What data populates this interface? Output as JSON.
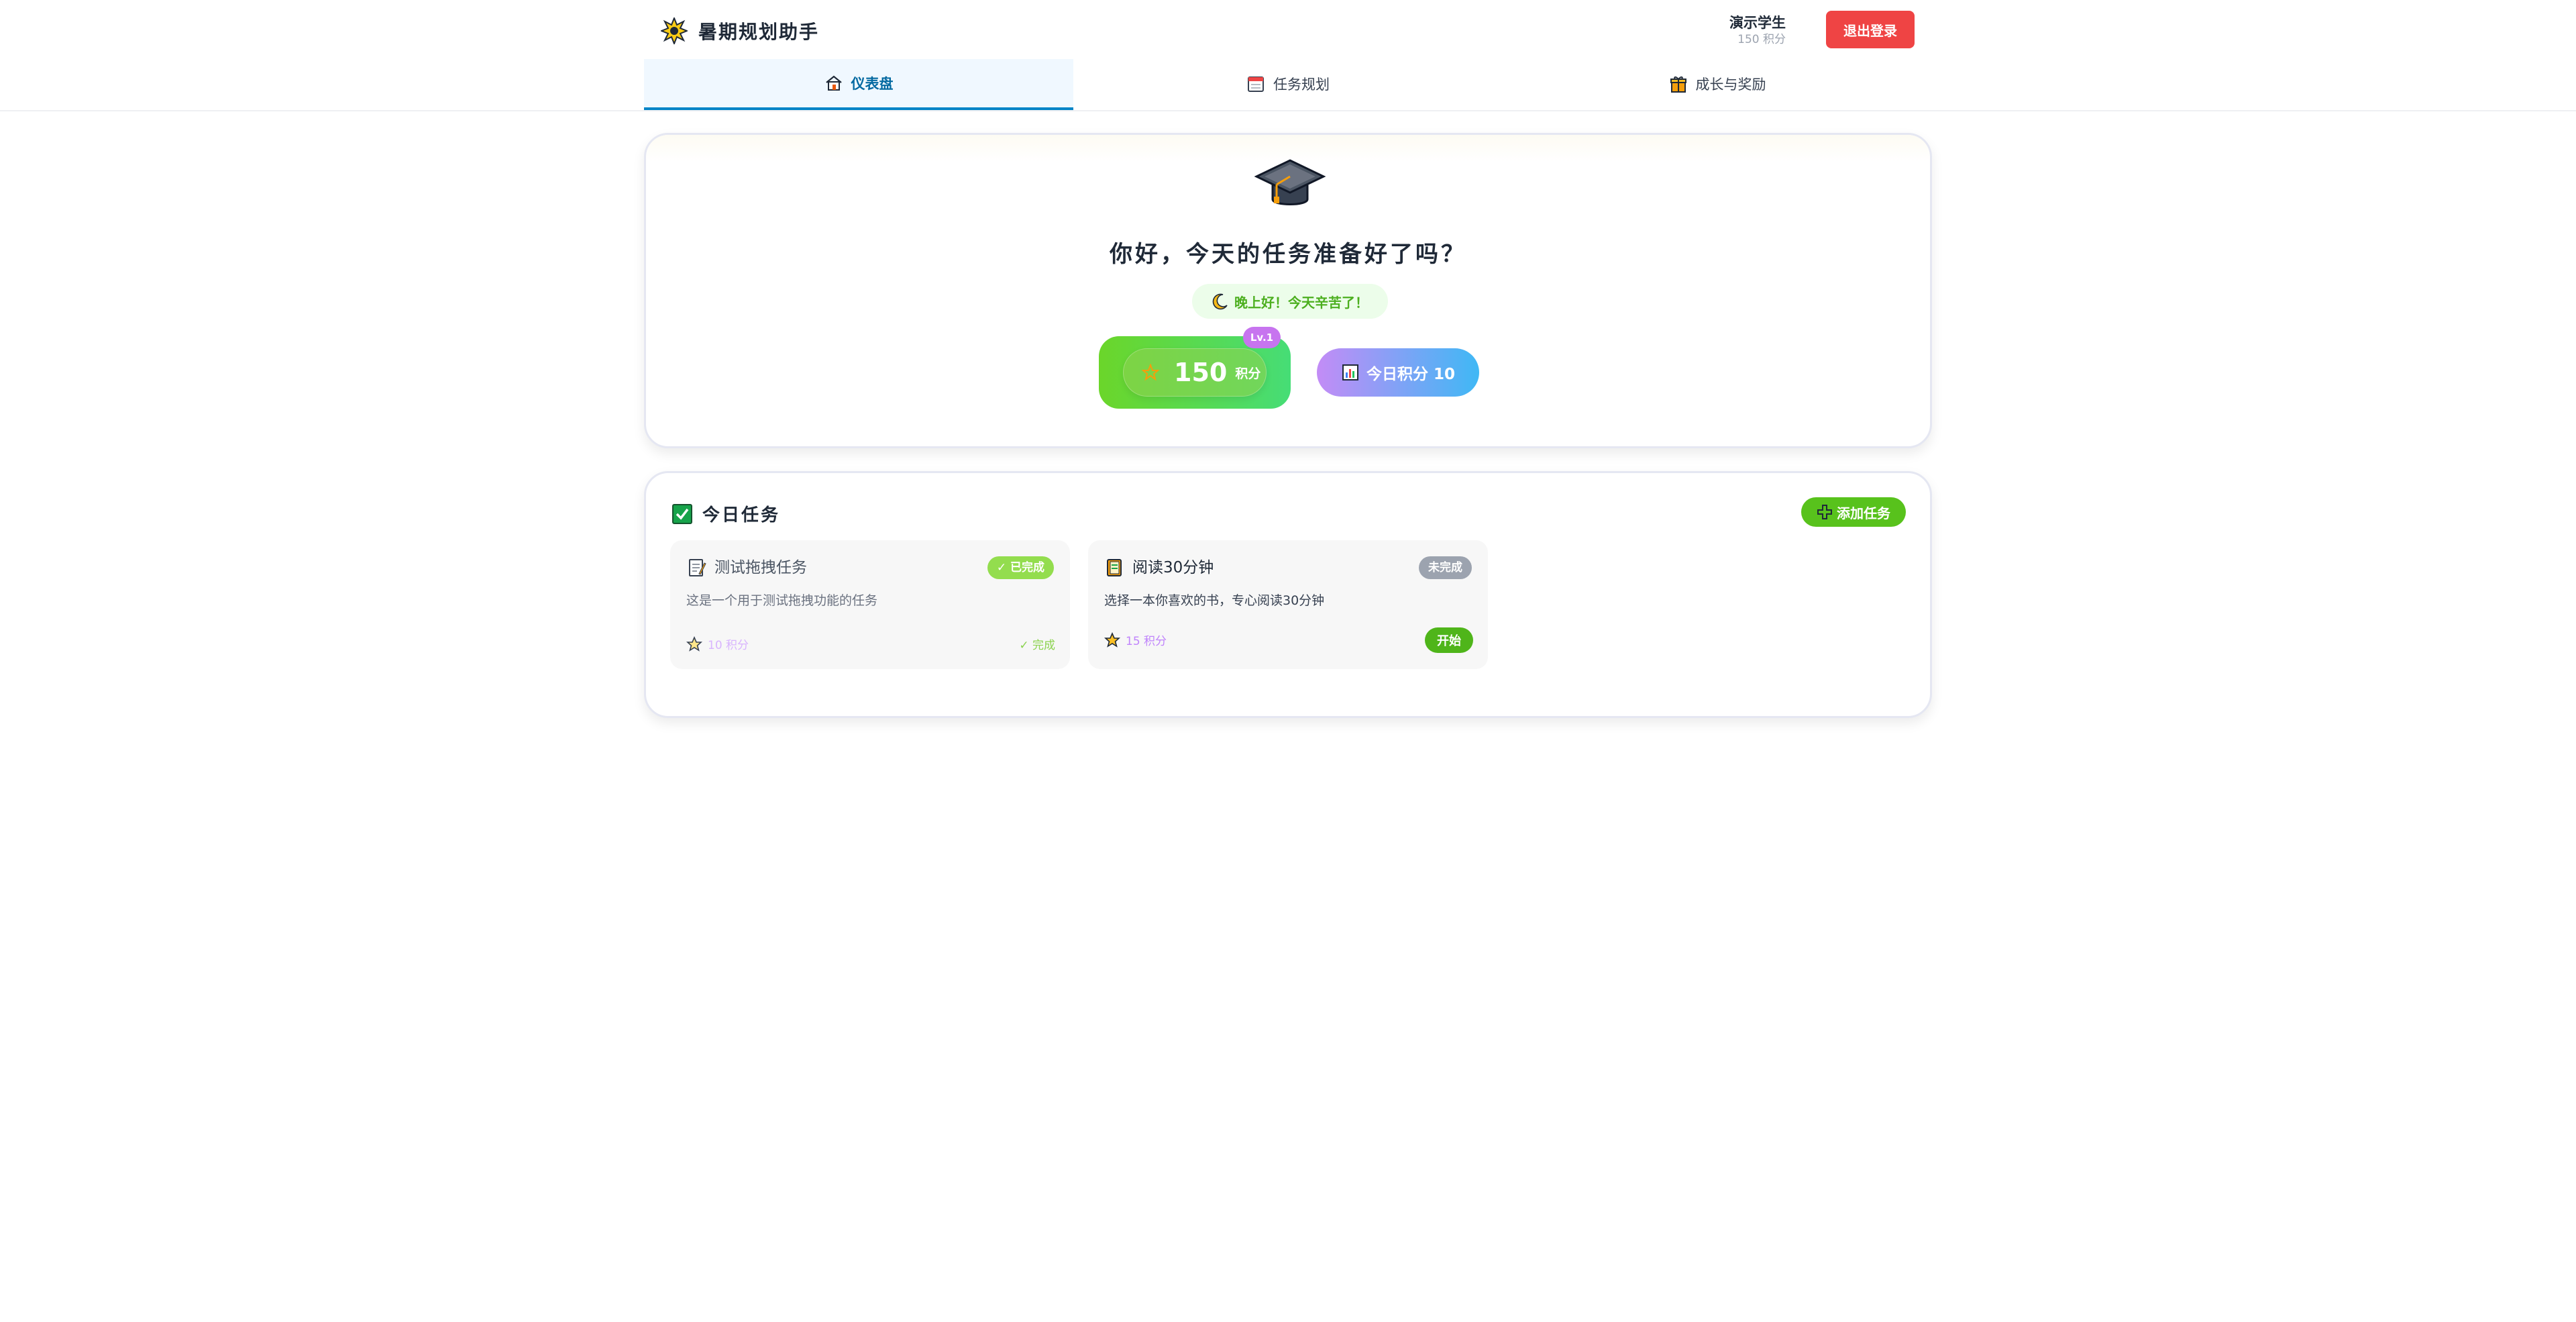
{
  "app": {
    "title": "暑期规划助手",
    "icon": "sparkle-icon"
  },
  "user": {
    "name": "演示学生",
    "points": "150 积分",
    "logout_label": "退出登录"
  },
  "tabs": [
    {
      "label": "仪表盘",
      "icon": "home-icon",
      "active": true
    },
    {
      "label": "任务规划",
      "icon": "calendar-icon",
      "active": false
    },
    {
      "label": "成长与奖励",
      "icon": "gift-icon",
      "active": false
    }
  ],
  "welcome": {
    "icon": "graduation-cap-icon",
    "greeting": "你好，今天的任务准备好了吗？",
    "evening_message": "晚上好！今天辛苦了！",
    "total_points": "150",
    "points_unit": "积分",
    "level": "Lv.1",
    "today_points_label": "今日积分 10"
  },
  "tasks": {
    "title": "今日任务",
    "add_label": "添加任务",
    "items": [
      {
        "title": "测试拖拽任务",
        "description": "这是一个用于测试拖拽功能的任务",
        "status": "✓ 已完成",
        "points": "10 积分",
        "action": "✓ 完成",
        "icon": "memo-icon"
      },
      {
        "title": "阅读30分钟",
        "description": "选择一本你喜欢的书，专心阅读30分钟",
        "status": "未完成",
        "points": "15 积分",
        "action": "开始",
        "icon": "book-icon"
      }
    ]
  },
  "colors": {
    "danger": "#ef4444",
    "accent": "#0284c7",
    "green": "#58c21c",
    "purple": "#c774ef"
  }
}
